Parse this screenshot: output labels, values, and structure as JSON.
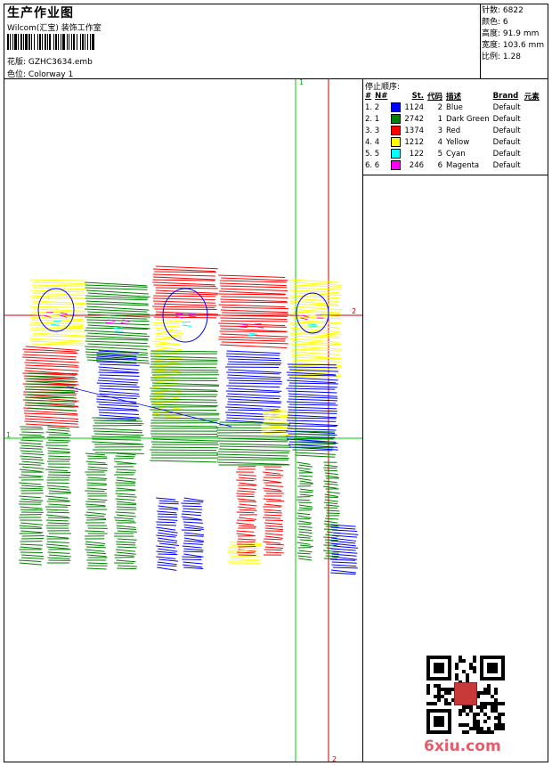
{
  "header": {
    "title": "生产作业图",
    "company": "Wilcom(汇宝) 装饰工作室",
    "design_label": "花版:",
    "design_value": "GZHC3634.emb",
    "colorway_label": "色位:",
    "colorway_value": "Colorway 1"
  },
  "stats": {
    "stitches_label": "针数:",
    "stitches": "6822",
    "colors_label": "颜色:",
    "colors": "6",
    "height_label": "高度:",
    "height": "91.9 mm",
    "width_label": "宽度:",
    "width": "103.6 mm",
    "scale_label": "比例:",
    "scale": "1.28"
  },
  "stop_sequence": {
    "title": "停止顺序:",
    "headers": [
      "#",
      "N#",
      "St.",
      "代码",
      "描述",
      "Brand",
      "元素"
    ],
    "rows": [
      {
        "idx": "1. 2",
        "color": "#0000ff",
        "stitches": "1124",
        "code": "2",
        "desc": "Blue",
        "brand": "Default"
      },
      {
        "idx": "2. 1",
        "color": "#008000",
        "stitches": "2742",
        "code": "1",
        "desc": "Dark Green",
        "brand": "Default"
      },
      {
        "idx": "3. 3",
        "color": "#ff0000",
        "stitches": "1374",
        "code": "3",
        "desc": "Red",
        "brand": "Default"
      },
      {
        "idx": "4. 4",
        "color": "#ffff00",
        "stitches": "1212",
        "code": "4",
        "desc": "Yellow",
        "brand": "Default"
      },
      {
        "idx": "5. 5",
        "color": "#00ffff",
        "stitches": "122",
        "code": "5",
        "desc": "Cyan",
        "brand": "Default"
      },
      {
        "idx": "6. 6",
        "color": "#ff00ff",
        "stitches": "246",
        "code": "6",
        "desc": "Magenta",
        "brand": "Default"
      }
    ]
  },
  "guides": {
    "green_top": "1",
    "green_left": "1",
    "red_right": "2",
    "red_bottom": "2",
    "green_color": "#00cc00",
    "red_color": "#cc0000"
  },
  "watermark": "6xiu.com"
}
